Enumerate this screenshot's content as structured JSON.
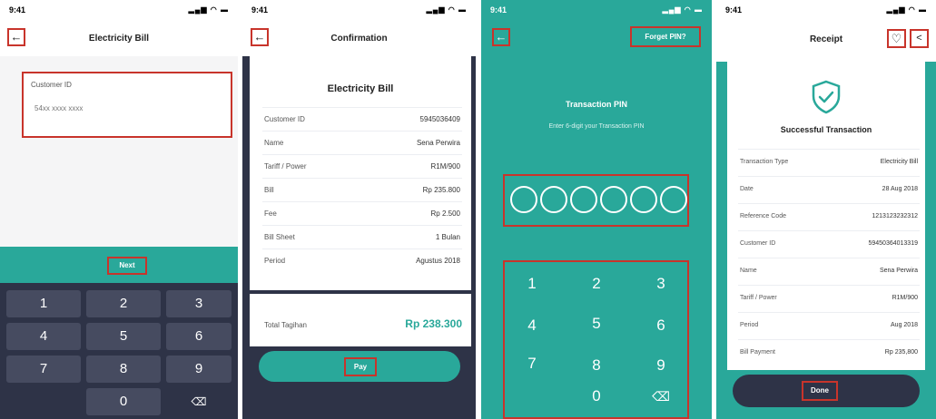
{
  "status": {
    "time": "9:41",
    "signal": "▂▄▆ ◠ ▬"
  },
  "icons": {
    "back": "arrow-left-icon",
    "heart": "heart-icon",
    "share": "share-icon",
    "backspace": "backspace-icon",
    "shield": "shield-check-icon"
  },
  "colors": {
    "teal": "#29a89a",
    "navy": "#2e3347",
    "highlight": "#c8342b"
  },
  "screen1": {
    "title": "Electricity Bill",
    "field_label": "Customer ID",
    "field_placeholder": "54xx xxxx xxxx",
    "next_label": "Next",
    "keys": [
      "1",
      "2",
      "3",
      "4",
      "5",
      "6",
      "7",
      "8",
      "9",
      "",
      "0",
      "⌫"
    ]
  },
  "screen2": {
    "title": "Confirmation",
    "card_title": "Electricity Bill",
    "rows": [
      {
        "label": "Customer ID",
        "value": "5945036409"
      },
      {
        "label": "Name",
        "value": "Sena Perwira"
      },
      {
        "label": "Tariff / Power",
        "value": "R1M/900"
      },
      {
        "label": "Bill",
        "value": "Rp 235.800"
      },
      {
        "label": "Fee",
        "value": "Rp 2.500"
      },
      {
        "label": "Bill Sheet",
        "value": "1 Bulan"
      },
      {
        "label": "Period",
        "value": "Agustus 2018"
      }
    ],
    "total_label": "Total Tagihan",
    "total_value": "Rp 238.300",
    "pay_label": "Pay"
  },
  "screen3": {
    "forgot_label": "Forget PIN?",
    "title": "Transaction PIN",
    "subtitle": "Enter 6-digit your Transaction PIN",
    "keys": [
      "1",
      "2",
      "3",
      "4",
      "5",
      "6",
      "7",
      "8",
      "9",
      "",
      "0",
      "⌫"
    ]
  },
  "screen4": {
    "title": "Receipt",
    "success": "Successful Transaction",
    "rows": [
      {
        "label": "Transaction Type",
        "value": "Electricity Bill"
      },
      {
        "label": "Date",
        "value": "28 Aug 2018"
      },
      {
        "label": "Reference Code",
        "value": "1213123232312"
      },
      {
        "label": "Customer ID",
        "value": "59450364013319"
      },
      {
        "label": "Name",
        "value": "Sena Perwira"
      },
      {
        "label": "Tariff / Power",
        "value": "R1M/900"
      },
      {
        "label": "Period",
        "value": "Aug 2018"
      },
      {
        "label": "Bill Payment",
        "value": "Rp 235,800"
      }
    ],
    "done_label": "Done"
  }
}
